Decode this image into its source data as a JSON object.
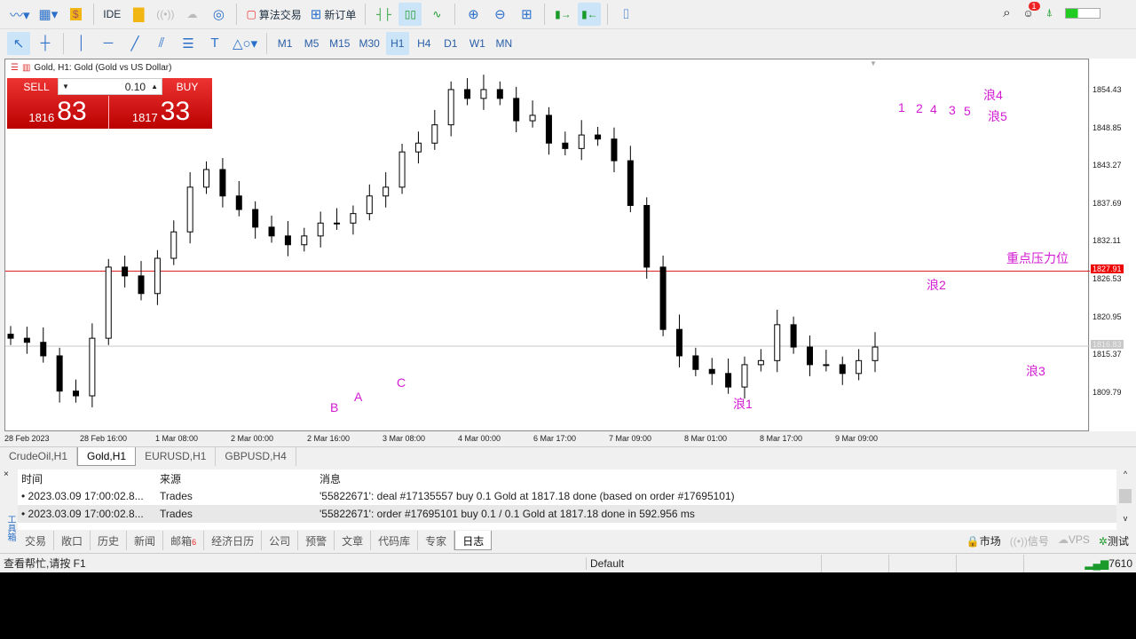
{
  "toolbar1": {
    "ide": "IDE",
    "algo": "算法交易",
    "new_order": "新订单"
  },
  "toolbar2": {
    "timeframes": [
      "M1",
      "M5",
      "M15",
      "M30",
      "H1",
      "H4",
      "D1",
      "W1",
      "MN"
    ],
    "active": "H1"
  },
  "notification_count": "1",
  "chart": {
    "title": "Gold, H1:  Gold (Gold vs US Dollar)",
    "trade_panel": {
      "sell": "SELL",
      "buy": "BUY",
      "volume": "0.10",
      "bid_big": "1816",
      "bid_small": "83",
      "ask_big": "1817",
      "ask_small": "33"
    },
    "labels": {
      "b": "B",
      "a": "A",
      "c": "C",
      "w1": "浪1",
      "w2": "浪2",
      "w3": "浪3",
      "w4": "浪4",
      "w5": "浪5",
      "n1": "1",
      "n2": "2",
      "n4": "4",
      "n3": "3",
      "n5": "5",
      "resistance": "重点压力位"
    },
    "resistance_price": "1827.91",
    "bid_price": "1816.83"
  },
  "chart_data": {
    "type": "candlestick",
    "price_ticks": [
      "1854.43",
      "1848.85",
      "1843.27",
      "1837.69",
      "1832.11",
      "1826.53",
      "1820.95",
      "1815.37",
      "1809.79"
    ],
    "time_ticks": [
      "28 Feb 2023",
      "28 Feb 16:00",
      "1 Mar 08:00",
      "2 Mar 00:00",
      "2 Mar 16:00",
      "3 Mar 08:00",
      "4 Mar 00:00",
      "6 Mar 17:00",
      "7 Mar 09:00",
      "8 Mar 01:00",
      "8 Mar 17:00",
      "9 Mar 09:00"
    ],
    "ylim": [
      1805,
      1860
    ],
    "closes": [
      1818.0,
      1817.4,
      1815.4,
      1810.2,
      1809.5,
      1818.0,
      1828.5,
      1827.2,
      1824.6,
      1829.8,
      1833.7,
      1840.3,
      1842.9,
      1839.0,
      1837.0,
      1834.4,
      1833.1,
      1831.8,
      1833.1,
      1835.0,
      1835.0,
      1836.4,
      1839.0,
      1840.3,
      1845.5,
      1846.8,
      1849.5,
      1854.7,
      1853.4,
      1854.7,
      1853.4,
      1850.1,
      1850.9,
      1846.8,
      1846.0,
      1848.0,
      1847.4,
      1844.2,
      1837.6,
      1828.5,
      1819.3,
      1815.4,
      1813.4,
      1812.8,
      1810.8,
      1814.1,
      1814.7,
      1820.0,
      1816.7,
      1814.1,
      1814.1,
      1812.8,
      1814.7,
      1816.7
    ],
    "hlines": [
      {
        "price": 1827.91,
        "color": "#e02020"
      },
      {
        "price": 1816.83,
        "color": "#c8c8c8"
      }
    ]
  },
  "symbol_tabs": [
    "CrudeOil,H1",
    "Gold,H1",
    "EURUSD,H1",
    "GBPUSD,H4"
  ],
  "active_symbol_tab": "Gold,H1",
  "log": {
    "headers": [
      "时间",
      "来源",
      "消息"
    ],
    "rows": [
      [
        "2023.03.09 17:00:02.8...",
        "Trades",
        "'55822671': deal #17135557 buy 0.1 Gold at 1817.18 done (based on order #17695101)"
      ],
      [
        "2023.03.09 17:00:02.8...",
        "Trades",
        "'55822671': order #17695101 buy 0.1 / 0.1 Gold at 1817.18 done in 592.956 ms"
      ]
    ]
  },
  "toolbox_tabs": [
    "交易",
    "敞口",
    "历史",
    "新闻",
    "邮箱",
    "经济日历",
    "公司",
    "预警",
    "文章",
    "代码库",
    "专家",
    "日志"
  ],
  "mail_count": "6",
  "active_toolbox_tab": "日志",
  "toolbox_label": "工具箱",
  "right_tabs": [
    "市场",
    "信号",
    "VPS",
    "测试"
  ],
  "status": {
    "help": "查看帮忙,请按 F1",
    "profile": "Default",
    "ping": "7610"
  }
}
